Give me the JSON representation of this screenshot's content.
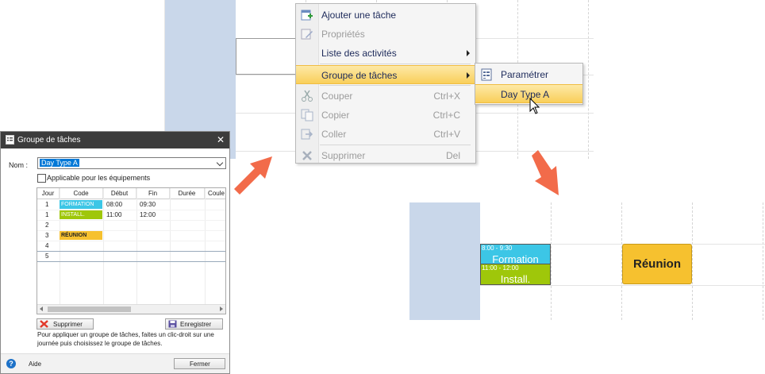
{
  "context_menu": {
    "items": [
      {
        "label": "Ajouter une tâche",
        "shortcut": "",
        "icon": "add-task-icon",
        "enabled": true
      },
      {
        "label": "Propriétés",
        "shortcut": "",
        "icon": "properties-icon",
        "enabled": false
      },
      {
        "label": "Liste des activités",
        "shortcut": "",
        "icon": "",
        "enabled": true,
        "submenu": true
      },
      {
        "label": "Groupe de tâches",
        "shortcut": "",
        "icon": "",
        "enabled": true,
        "submenu": true,
        "highlighted": true
      },
      {
        "label": "Couper",
        "shortcut": "Ctrl+X",
        "icon": "cut-icon",
        "enabled": false
      },
      {
        "label": "Copier",
        "shortcut": "Ctrl+C",
        "icon": "copy-icon",
        "enabled": false
      },
      {
        "label": "Coller",
        "shortcut": "Ctrl+V",
        "icon": "paste-icon",
        "enabled": false
      },
      {
        "label": "Supprimer",
        "shortcut": "Del",
        "icon": "delete-icon",
        "enabled": false
      }
    ]
  },
  "submenu": {
    "items": [
      {
        "label": "Paramétrer",
        "icon": "configure-icon"
      },
      {
        "label": "Day Type A",
        "highlighted": true
      }
    ]
  },
  "dialog": {
    "title": "Groupe de tâches",
    "name_label": "Nom :",
    "name_value": "Day Type A",
    "checkbox_label": "Applicable pour les équipements",
    "columns": [
      "Jour",
      "Code",
      "Début",
      "Fin",
      "Durée",
      "Coule"
    ],
    "rows": [
      {
        "jour": "1",
        "code": "FORMATION",
        "code_color": "#3cc6e6",
        "debut": "08:00",
        "fin": "09:30"
      },
      {
        "jour": "1",
        "code": "INSTALL.",
        "code_color": "#9fc70a",
        "debut": "11:00",
        "fin": "12:00"
      },
      {
        "jour": "2",
        "code": "",
        "code_color": "",
        "debut": "",
        "fin": ""
      },
      {
        "jour": "3",
        "code": "RÉUNION",
        "code_color": "#f6c12f",
        "debut": "",
        "fin": ""
      },
      {
        "jour": "4",
        "code": "",
        "code_color": "",
        "debut": "",
        "fin": ""
      },
      {
        "jour": "5",
        "code": "",
        "code_color": "",
        "debut": "",
        "fin": ""
      }
    ],
    "delete_label": "Supprimer",
    "save_label": "Enregistrer",
    "note": "Pour appliquer un groupe de tâches, faites un clic-droit sur une journée puis choisissez le groupe de tâches.",
    "help_label": "Aide",
    "close_label": "Fermer"
  },
  "result_calendar": {
    "tasks": [
      {
        "time": "8:00 - 9:30",
        "name": "Formation",
        "color": "#3cc6e6"
      },
      {
        "time": "11:00 - 12:00",
        "name": "Install.",
        "color": "#9fc70a"
      },
      {
        "time": "",
        "name": "Réunion",
        "color": "#f6c12f"
      }
    ]
  },
  "colors": {
    "arrow": "#f26b4a",
    "menu_highlight": "#f9cf5a",
    "day_column": "#c9d7ea"
  }
}
